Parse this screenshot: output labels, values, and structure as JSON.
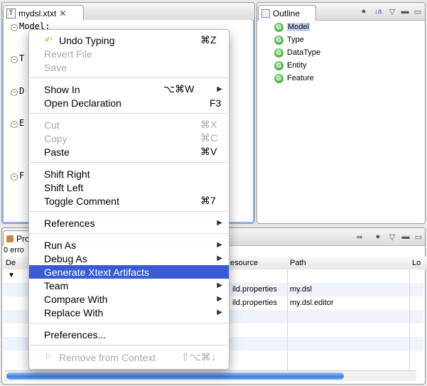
{
  "editor": {
    "tab_title": "mydsl.xtxt",
    "lines": [
      "Model:",
      "T",
      "D",
      "E",
      "F"
    ]
  },
  "outline": {
    "tab_title": "Outline",
    "items": [
      "Model",
      "Type",
      "DataType",
      "Entity",
      "Feature"
    ]
  },
  "problems": {
    "tab_title": "Pro",
    "summary": "0 erro",
    "columns": [
      "De",
      "esource",
      "Path",
      "Lo"
    ],
    "rows": [
      {
        "resource": "ild.properties",
        "path": "my.dsl"
      },
      {
        "resource": "ild.properties",
        "path": "my.dsl.editor"
      }
    ]
  },
  "context_menu": {
    "undo": {
      "label": "Undo Typing",
      "shortcut": "⌘Z"
    },
    "revert": {
      "label": "Revert File"
    },
    "save": {
      "label": "Save"
    },
    "show_in": {
      "label": "Show In",
      "shortcut": "⌥⌘W"
    },
    "open_declaration": {
      "label": "Open Declaration",
      "shortcut": "F3"
    },
    "cut": {
      "label": "Cut",
      "shortcut": "⌘X"
    },
    "copy": {
      "label": "Copy",
      "shortcut": "⌘C"
    },
    "paste": {
      "label": "Paste",
      "shortcut": "⌘V"
    },
    "shift_right": {
      "label": "Shift Right"
    },
    "shift_left": {
      "label": "Shift Left"
    },
    "toggle_comment": {
      "label": "Toggle Comment",
      "shortcut": "⌘7"
    },
    "references": {
      "label": "References"
    },
    "run_as": {
      "label": "Run As"
    },
    "debug_as": {
      "label": "Debug As"
    },
    "generate": {
      "label": "Generate Xtext Artifacts"
    },
    "team": {
      "label": "Team"
    },
    "compare_with": {
      "label": "Compare With"
    },
    "replace_with": {
      "label": "Replace With"
    },
    "preferences": {
      "label": "Preferences..."
    },
    "remove_context": {
      "label": "Remove from Context",
      "shortcut": "⇧⌥⌘↓"
    }
  },
  "colors": {
    "selection": "#3a5bd6",
    "outline_highlight": "#c5d4f0",
    "icon_green": "#2f9b2f"
  }
}
